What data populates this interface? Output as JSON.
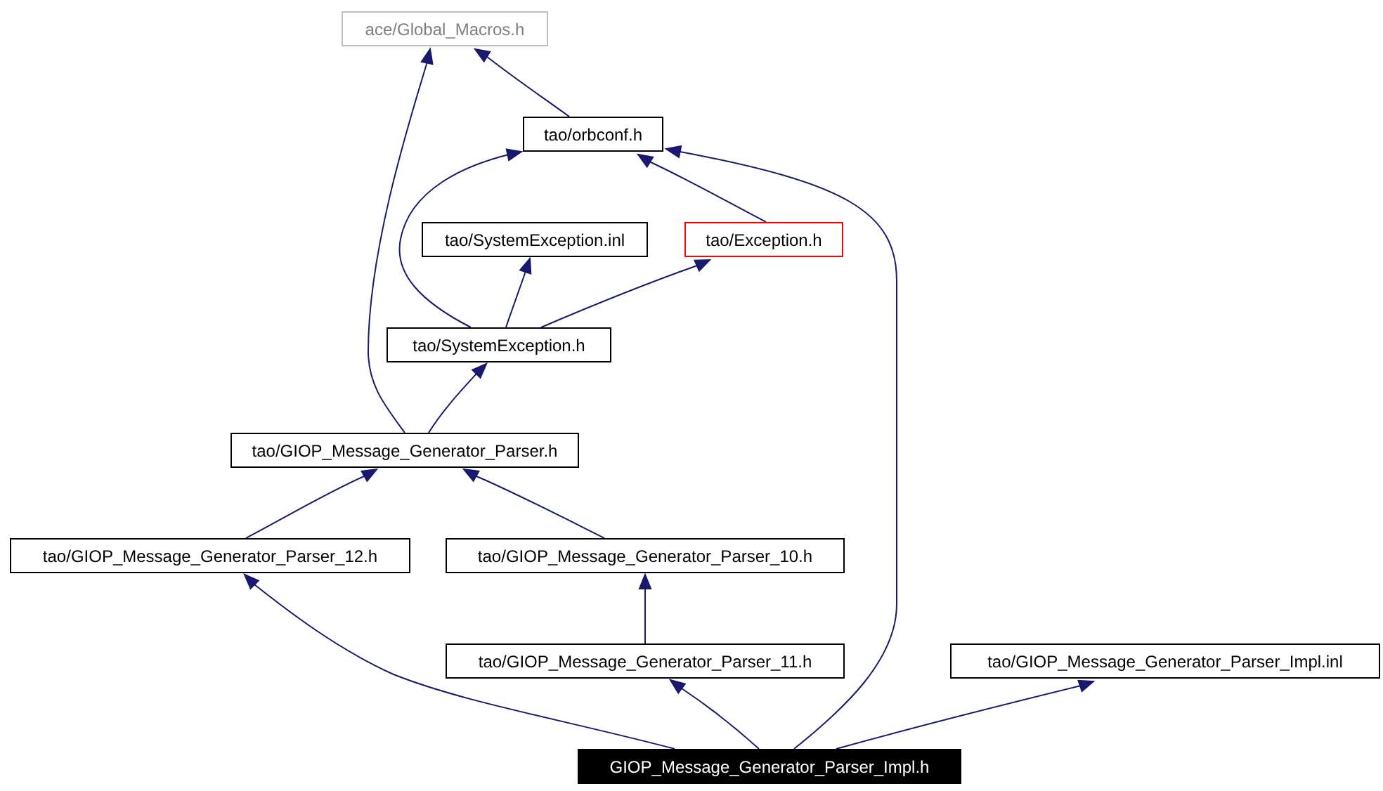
{
  "graph": {
    "nodes": [
      {
        "label": "ace/Global_Macros.h",
        "kind": "external"
      },
      {
        "label": "tao/orbconf.h",
        "kind": "normal"
      },
      {
        "label": "tao/SystemException.inl",
        "kind": "normal"
      },
      {
        "label": "tao/Exception.h",
        "kind": "truncated"
      },
      {
        "label": "tao/SystemException.h",
        "kind": "normal"
      },
      {
        "label": "tao/GIOP_Message_Generator_Parser.h",
        "kind": "normal"
      },
      {
        "label": "tao/GIOP_Message_Generator_Parser_12.h",
        "kind": "normal"
      },
      {
        "label": "tao/GIOP_Message_Generator_Parser_10.h",
        "kind": "normal"
      },
      {
        "label": "tao/GIOP_Message_Generator_Parser_11.h",
        "kind": "normal"
      },
      {
        "label": "tao/GIOP_Message_Generator_Parser_Impl.inl",
        "kind": "normal"
      },
      {
        "label": "GIOP_Message_Generator_Parser_Impl.h",
        "kind": "current"
      }
    ]
  }
}
